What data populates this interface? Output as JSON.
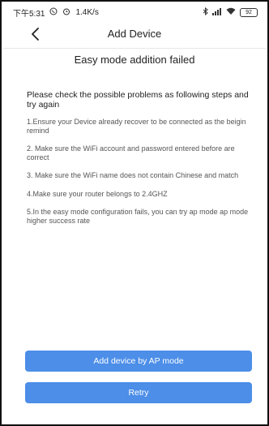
{
  "status_bar": {
    "time": "下午5:31",
    "speed": "1.4K/s",
    "battery": "92",
    "icons": [
      "whatsapp-icon",
      "alarm-icon",
      "bluetooth-icon",
      "signal-icon",
      "wifi-icon",
      "battery-icon"
    ]
  },
  "nav": {
    "title": "Add Device",
    "back_icon": "chevron-left-icon"
  },
  "page": {
    "heading": "Easy mode addition failed",
    "intro": "Please check the possible problems as following steps and try again",
    "steps": [
      "1.Ensure your Device already recover to be connected as the beigin remind",
      "2. Make sure the WiFi account and password entered before are correct",
      "3. Make sure the WiFi name does not contain Chinese and match",
      "4.Make sure your router belongs to 2.4GHZ",
      "5.In the easy mode configuration fails, you can try ap mode ap mode higher success rate"
    ]
  },
  "buttons": {
    "ap_mode": "Add device by AP mode",
    "retry": "Retry"
  },
  "colors": {
    "accent": "#4c8ee8"
  }
}
